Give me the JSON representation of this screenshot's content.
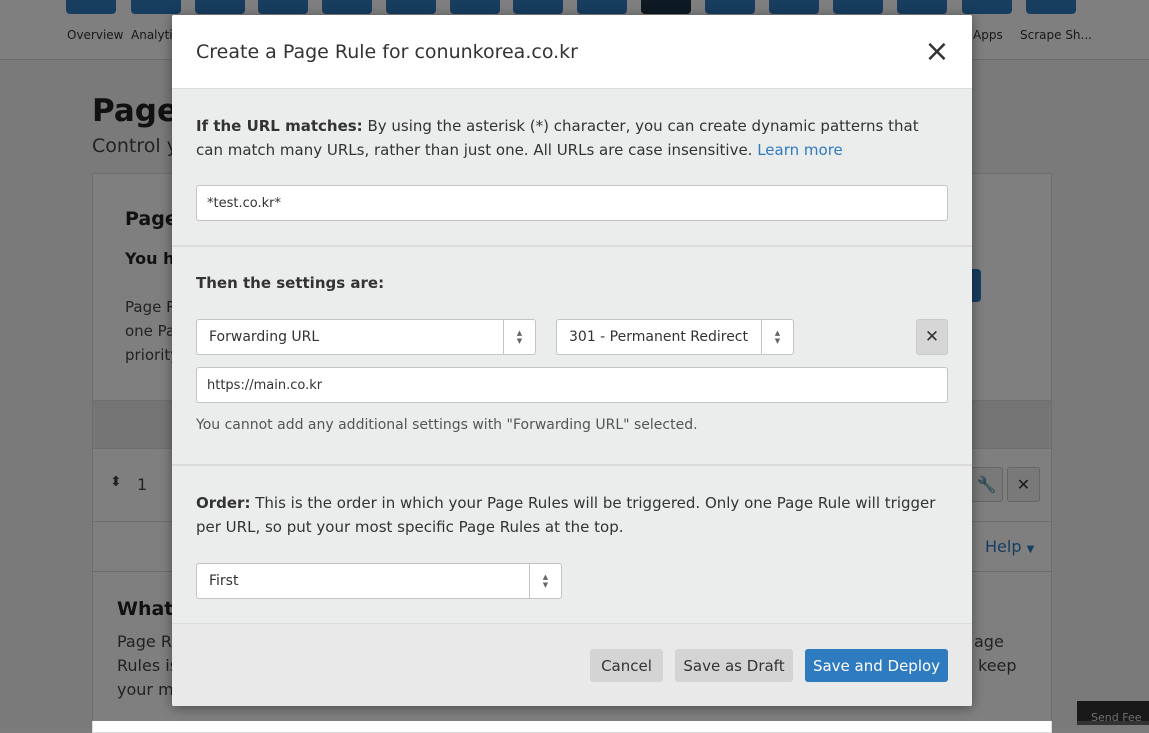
{
  "background": {
    "nav": {
      "items": [
        {
          "label": "Overview"
        },
        {
          "label": "Analytics"
        },
        {
          "label": "Apps"
        },
        {
          "label": "Scrape Sh..."
        }
      ]
    },
    "page_title": "Page",
    "page_subtitle": "Control y",
    "panel": {
      "title": "Page",
      "bold_line": "You h",
      "text_lines": [
        "Page R",
        "one Pa",
        "priority"
      ],
      "row_number": "1",
      "help_label": "Help",
      "what_heading": "What",
      "bottom_left_lines": [
        "Page Ru",
        "Rules is",
        "your mo"
      ],
      "bottom_right_lines": [
        "age",
        "keep"
      ]
    },
    "send_feedback": "Send Fee"
  },
  "modal": {
    "title": "Create a Page Rule for conunkorea.co.kr",
    "url_section": {
      "label": "If the URL matches:",
      "description": " By using the asterisk (*) character, you can create dynamic patterns that can match many URLs, rather than just one. All URLs are case insensitive. ",
      "learn_more": "Learn more",
      "url_value": "*test.co.kr*"
    },
    "settings_section": {
      "label": "Then the settings are:",
      "setting_select": "Forwarding URL",
      "status_select": "301 - Permanent Redirect",
      "destination_value": "https://main.co.kr",
      "note": "You cannot add any additional settings with \"Forwarding URL\" selected."
    },
    "order_section": {
      "label": "Order:",
      "description": " This is the order in which your Page Rules will be triggered. Only one Page Rule will trigger per URL, so put your most specific Page Rules at the top.",
      "order_select": "First"
    },
    "footer": {
      "cancel_label": "Cancel",
      "draft_label": "Save as Draft",
      "deploy_label": "Save and Deploy"
    }
  },
  "colors": {
    "primary": "#2f7bbf",
    "overlay": "rgba(0,0,0,0.5)"
  }
}
